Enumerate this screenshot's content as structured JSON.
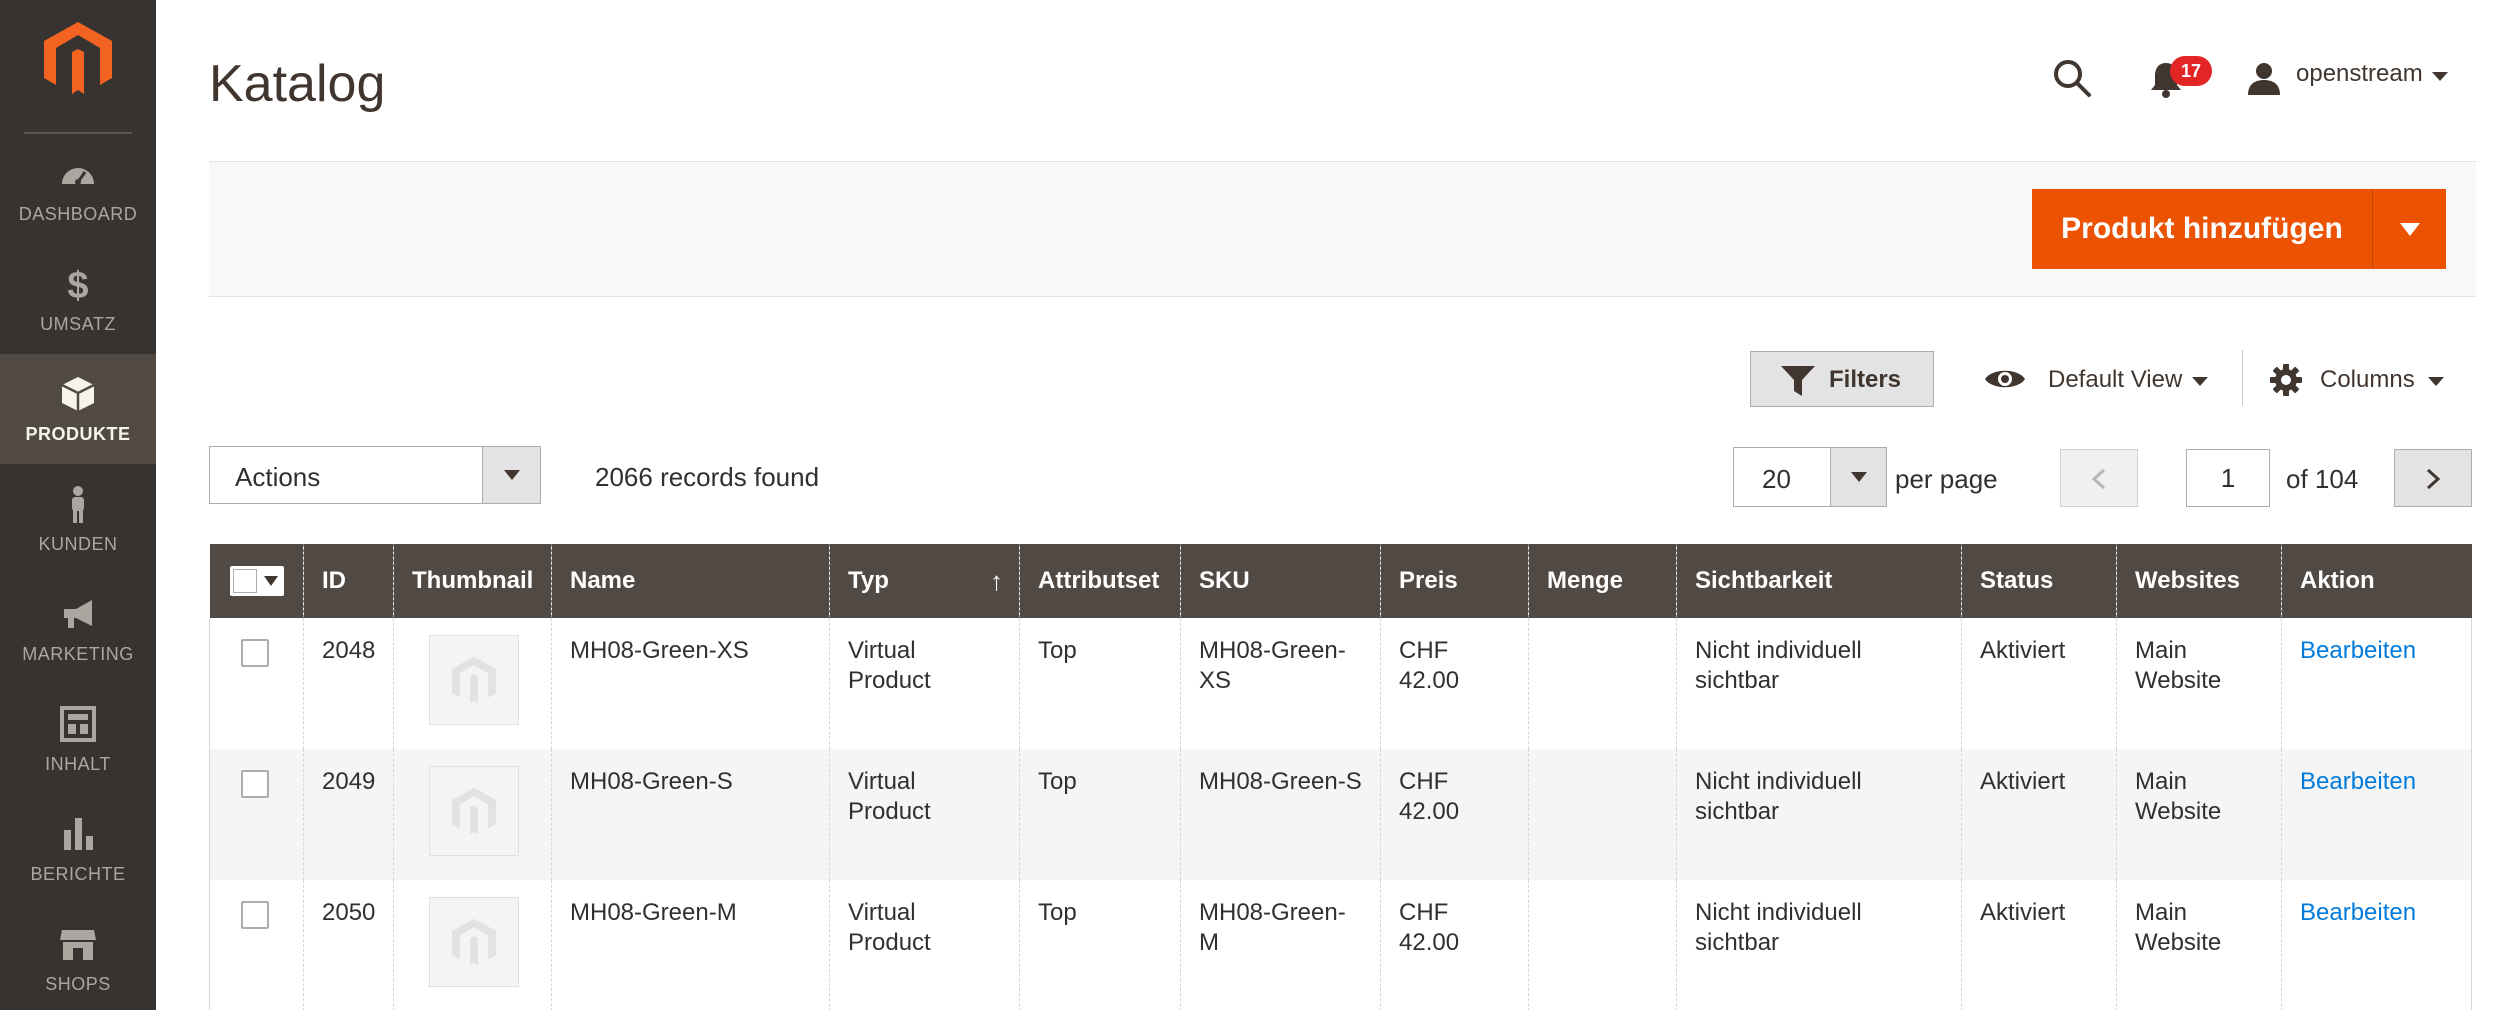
{
  "sidebar": {
    "items": [
      {
        "label": "DASHBOARD",
        "icon": "dashboard-icon",
        "active": false
      },
      {
        "label": "UMSATZ",
        "icon": "dollar-icon",
        "active": false
      },
      {
        "label": "PRODUKTE",
        "icon": "box-icon",
        "active": true
      },
      {
        "label": "KUNDEN",
        "icon": "person-icon",
        "active": false
      },
      {
        "label": "MARKETING",
        "icon": "megaphone-icon",
        "active": false
      },
      {
        "label": "INHALT",
        "icon": "layout-icon",
        "active": false
      },
      {
        "label": "BERICHTE",
        "icon": "bar-chart-icon",
        "active": false
      },
      {
        "label": "SHOPS",
        "icon": "store-icon",
        "active": false
      }
    ]
  },
  "header": {
    "title": "Katalog",
    "notification_count": "17",
    "username": "openstream"
  },
  "page_actions": {
    "add_product_label": "Produkt hinzufügen"
  },
  "toolbar": {
    "filters_label": "Filters",
    "view_label": "Default View",
    "columns_label": "Columns",
    "actions_label": "Actions",
    "records_found": "2066 records found",
    "per_page_value": "20",
    "per_page_label": "per page",
    "current_page": "1",
    "page_total": "of 104"
  },
  "table": {
    "columns": [
      "ID",
      "Thumbnail",
      "Name",
      "Typ",
      "Attributset",
      "SKU",
      "Preis",
      "Menge",
      "Sichtbarkeit",
      "Status",
      "Websites",
      "Aktion"
    ],
    "sort_indicator": "↑",
    "rows": [
      {
        "id": "2048",
        "name": "MH08-Green-XS",
        "type": "Virtual Product",
        "attribute_set": "Top",
        "sku": "MH08-Green-XS",
        "price": "CHF 42.00",
        "qty": "",
        "visibility": "Nicht individuell sichtbar",
        "status": "Aktiviert",
        "websites": "Main Website",
        "action": "Bearbeiten"
      },
      {
        "id": "2049",
        "name": "MH08-Green-S",
        "type": "Virtual Product",
        "attribute_set": "Top",
        "sku": "MH08-Green-S",
        "price": "CHF 42.00",
        "qty": "",
        "visibility": "Nicht individuell sichtbar",
        "status": "Aktiviert",
        "websites": "Main Website",
        "action": "Bearbeiten"
      },
      {
        "id": "2050",
        "name": "MH08-Green-M",
        "type": "Virtual Product",
        "attribute_set": "Top",
        "sku": "MH08-Green-M",
        "price": "CHF 42.00",
        "qty": "",
        "visibility": "Nicht individuell sichtbar",
        "status": "Aktiviert",
        "websites": "Main Website",
        "action": "Bearbeiten"
      }
    ]
  },
  "colors": {
    "sidebar_bg": "#373330",
    "accent": "#eb5202",
    "table_header_bg": "#514943",
    "link": "#007bdb",
    "badge": "#e22626"
  }
}
